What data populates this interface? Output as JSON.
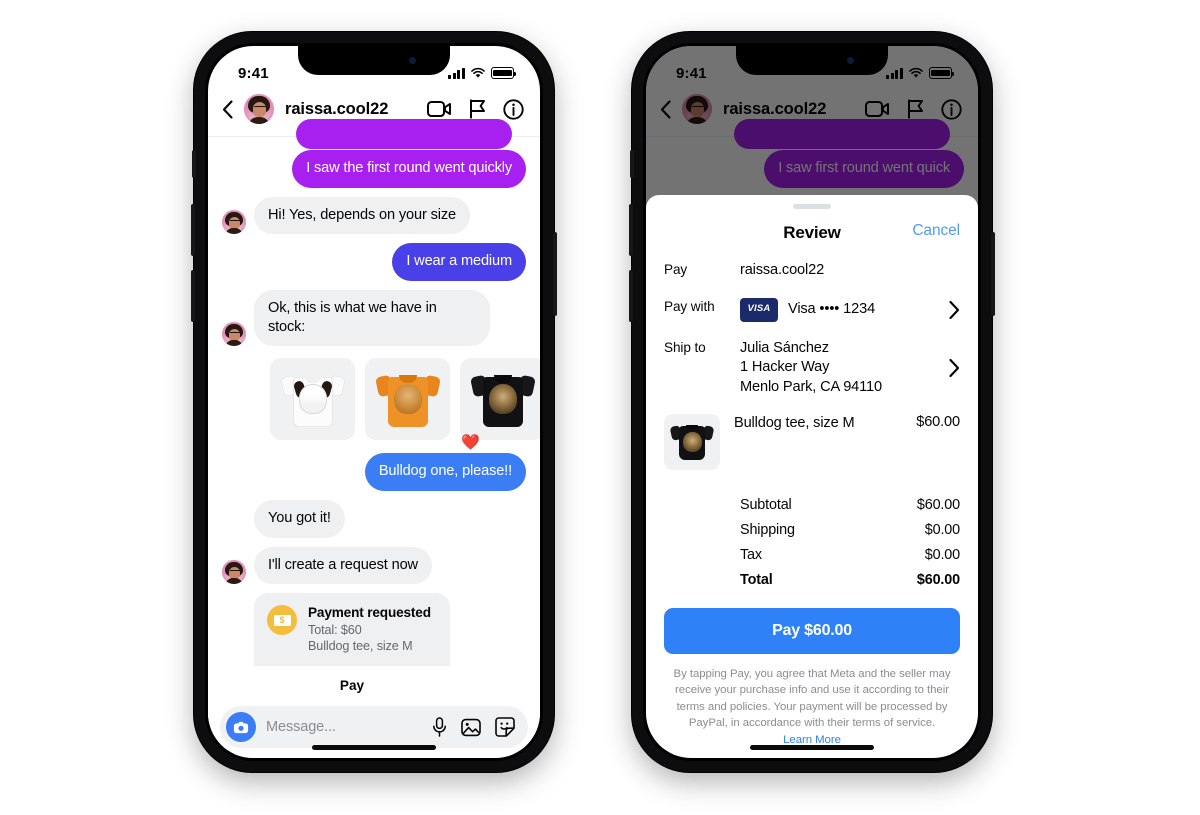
{
  "status_bar": {
    "time": "9:41",
    "signal_icon": "cellular-bars-icon",
    "wifi_icon": "wifi-icon",
    "battery_icon": "battery-full-icon"
  },
  "conversation": {
    "back_icon": "back-chevron-icon",
    "avatar_name": "avatar",
    "username": "raissa.cool22",
    "actions": [
      {
        "name": "video-call-icon",
        "label": "Video call"
      },
      {
        "name": "flag-icon",
        "label": "Flag"
      },
      {
        "name": "info-icon",
        "label": "Info"
      }
    ],
    "messages": [
      {
        "id": "m1",
        "dir": "out",
        "style": "magenta",
        "text": "I saw the first round went quickly"
      },
      {
        "id": "m2",
        "dir": "in",
        "style": "grey",
        "text": "Hi! Yes, depends on your size"
      },
      {
        "id": "m3",
        "dir": "out",
        "style": "indigo",
        "text": "I wear a medium"
      },
      {
        "id": "m4",
        "dir": "in",
        "style": "grey",
        "text": "Ok, this is what we have in stock:"
      },
      {
        "id": "m5",
        "dir": "out",
        "style": "blue",
        "text": "Bulldog one, please!!"
      },
      {
        "id": "m6",
        "dir": "in",
        "style": "grey",
        "text": "You got it!"
      },
      {
        "id": "m7",
        "dir": "in",
        "style": "grey",
        "text": "I'll create a request now"
      }
    ],
    "products": [
      {
        "name": "border-collie-tee",
        "alt": "White tee with collie dog print"
      },
      {
        "name": "golden-retriever-tee",
        "alt": "Orange tee with retriever dog print"
      },
      {
        "name": "bulldog-tee",
        "alt": "Black tee with bulldog print"
      }
    ],
    "reaction": "❤️",
    "payment_request": {
      "icon": "money-bill-icon",
      "title": "Payment requested",
      "total_line": "Total: $60",
      "item_line": "Bulldog tee, size M",
      "action_label": "Pay"
    },
    "composer": {
      "camera_icon": "camera-icon",
      "placeholder": "Message...",
      "icons": [
        {
          "name": "microphone-icon"
        },
        {
          "name": "photo-icon"
        },
        {
          "name": "sticker-icon"
        }
      ]
    }
  },
  "conversation_dimmed": {
    "username": "raissa.cool22",
    "visible_message": "I saw first round went quick"
  },
  "review_sheet": {
    "grabber": "sheet-grabber",
    "title": "Review",
    "cancel_label": "Cancel",
    "pay_label": "Pay",
    "pay_value": "raissa.cool22",
    "pay_with_label": "Pay with",
    "card_brand": "VISA",
    "card_value": "Visa •••• 1234",
    "ship_to_label": "Ship to",
    "ship_to_lines": [
      "Julia Sánchez",
      "1 Hacker Way",
      "Menlo Park, CA 94110"
    ],
    "item": {
      "name": "Bulldog tee, size M",
      "price": "$60.00",
      "thumb": "bulldog-tee-thumbnail"
    },
    "totals": [
      {
        "label": "Subtotal",
        "value": "$60.00",
        "bold": false
      },
      {
        "label": "Shipping",
        "value": "$0.00",
        "bold": false
      },
      {
        "label": "Tax",
        "value": "$0.00",
        "bold": false
      },
      {
        "label": "Total",
        "value": "$60.00",
        "bold": true
      }
    ],
    "cta_label": "Pay $60.00",
    "disclaimer": "By tapping Pay, you agree that Meta and the seller may receive your purchase info and use it according to their terms and policies. Your payment will be processed by PayPal, in accordance with their terms of service.",
    "learn_more_label": "Learn More"
  },
  "colors": {
    "magenta": "#a820f0",
    "indigo": "#4a40e8",
    "blue": "#3a7df5",
    "cta_blue": "#2e81f7",
    "link_blue": "#4f9cf7",
    "bubble_grey": "#eff0f2",
    "coin_yellow": "#f5bd3c",
    "visa_navy": "#1b2a6b"
  }
}
